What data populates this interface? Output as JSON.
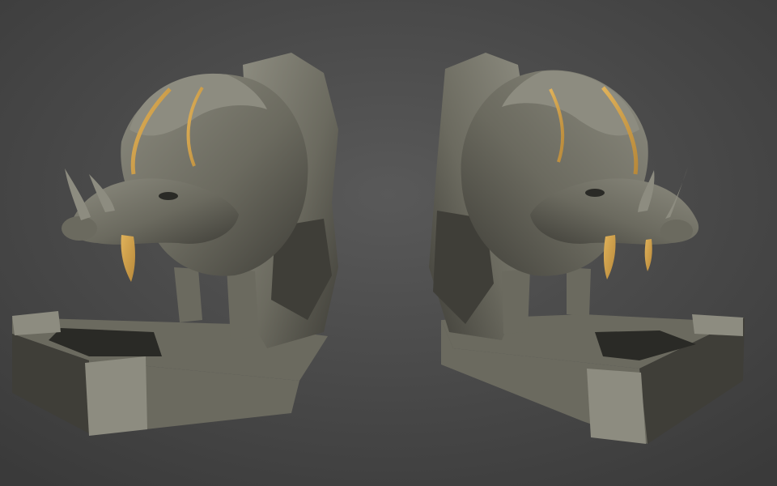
{
  "scene": {
    "background_center": "#595959",
    "background_edge": "#3a3a3a",
    "stone_light": "#8d8c80",
    "stone_mid": "#6b6a5f",
    "stone_dark": "#3f3e38",
    "stone_shadow": "#2a2a26",
    "gold_inlay": "#b8893a",
    "gold_highlight": "#e0b25a"
  }
}
